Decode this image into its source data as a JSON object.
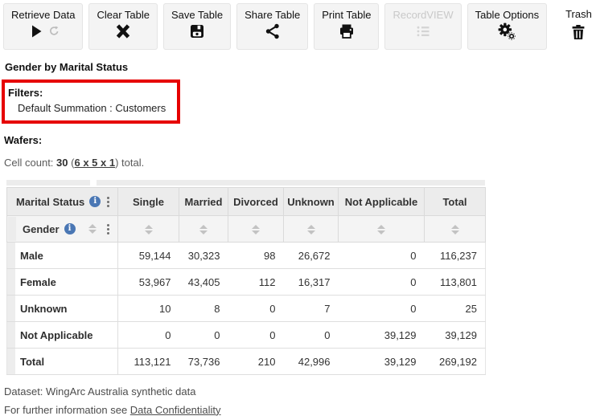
{
  "toolbar": {
    "buttons": [
      {
        "label": "Retrieve Data"
      },
      {
        "label": "Clear Table"
      },
      {
        "label": "Save Table"
      },
      {
        "label": "Share Table"
      },
      {
        "label": "Print Table"
      },
      {
        "label": "RecordVIEW"
      },
      {
        "label": "Table Options"
      }
    ],
    "trash_label": "Trash"
  },
  "page": {
    "title": "Gender by Marital Status"
  },
  "filters": {
    "heading": "Filters:",
    "value": "Default Summation : Customers"
  },
  "wafers": {
    "heading": "Wafers:"
  },
  "cell_count": {
    "prefix": "Cell count: ",
    "count": "30",
    "open_paren": "(",
    "link": "6 x 5 x 1",
    "close_paren": ")",
    "suffix": " total."
  },
  "table": {
    "col_dimension": "Marital Status",
    "row_dimension": "Gender",
    "columns": [
      "Single",
      "Married",
      "Divorced",
      "Unknown",
      "Not Applicable",
      "Total"
    ],
    "rows": [
      {
        "label": "Male",
        "values": [
          "59,144",
          "30,323",
          "98",
          "26,672",
          "0",
          "116,237"
        ]
      },
      {
        "label": "Female",
        "values": [
          "53,967",
          "43,405",
          "112",
          "16,317",
          "0",
          "113,801"
        ]
      },
      {
        "label": "Unknown",
        "values": [
          "10",
          "8",
          "0",
          "7",
          "0",
          "25"
        ]
      },
      {
        "label": "Not Applicable",
        "values": [
          "0",
          "0",
          "0",
          "0",
          "39,129",
          "39,129"
        ]
      },
      {
        "label": "Total",
        "values": [
          "113,121",
          "73,736",
          "210",
          "42,996",
          "39,129",
          "269,192"
        ]
      }
    ]
  },
  "footer": {
    "dataset_line": "Dataset: WingArc Australia synthetic data",
    "info_prefix": "For further information see ",
    "link": "Data Confidentiality"
  },
  "colors": {
    "accent_red": "#e60000",
    "info_blue": "#4a77b4",
    "header_gray": "#ececec"
  }
}
